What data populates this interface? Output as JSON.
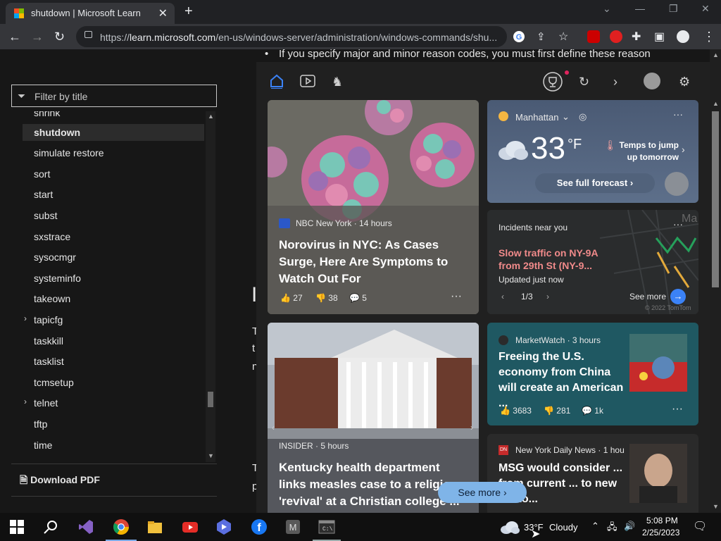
{
  "browser": {
    "tab_title": "shutdown | Microsoft Learn",
    "url_prefix": "https://",
    "url_host": "learn.microsoft.com",
    "url_path": "/en-us/windows-server/administration/windows-commands/shu..."
  },
  "sidebar": {
    "filter_placeholder": "Filter by title",
    "items": [
      {
        "label": "shrink"
      },
      {
        "label": "shutdown"
      },
      {
        "label": "simulate restore"
      },
      {
        "label": "sort"
      },
      {
        "label": "start"
      },
      {
        "label": "subst"
      },
      {
        "label": "sxstrace"
      },
      {
        "label": "sysocmgr"
      },
      {
        "label": "systeminfo"
      },
      {
        "label": "takeown"
      },
      {
        "label": "tapicfg"
      },
      {
        "label": "taskkill"
      },
      {
        "label": "tasklist"
      },
      {
        "label": "tcmsetup"
      },
      {
        "label": "telnet"
      },
      {
        "label": "tftp"
      },
      {
        "label": "time"
      }
    ],
    "download_pdf": "Download PDF"
  },
  "article": {
    "bullet_line": "If you specify major and minor reason codes, you must first define these reason"
  },
  "widgets": {
    "weather": {
      "location": "Manhattan",
      "temp": "33",
      "unit": "°F",
      "tip": "Temps to jump up tomorrow",
      "forecast_link": "See full forecast"
    },
    "traffic": {
      "title": "Incidents near you",
      "incident": "Slow traffic on NY-9A from 29th St (NY-9...",
      "updated": "Updated just now",
      "pager": "1/3",
      "see_more": "See more",
      "copyright": "© 2022 TomTom"
    },
    "news1": {
      "source": "NBC New York",
      "age": "14 hours",
      "headline": "Norovirus in NYC: As Cases Surge, Here Are Symptoms to Watch Out For",
      "likes": "27",
      "dislikes": "38",
      "comments": "5"
    },
    "news2": {
      "source": "MarketWatch",
      "age": "3 hours",
      "headline": "Freeing the U.S. economy from China will create an American ...",
      "likes": "3683",
      "dislikes": "281",
      "comments": "1k"
    },
    "news3": {
      "source": "INSIDER",
      "age": "5 hours",
      "headline": "Kentucky health department links measles case to a religious 'revival' at a Christian college ..."
    },
    "news4": {
      "source": "New York Daily News",
      "age": "1 hou",
      "headline": "MSG would consider ... from current ... to new Midto..."
    },
    "see_more_btn": "See more"
  },
  "taskbar": {
    "weather_temp": "33°F",
    "weather_cond": "Cloudy",
    "time": "5:08 PM",
    "date": "2/25/2023"
  }
}
